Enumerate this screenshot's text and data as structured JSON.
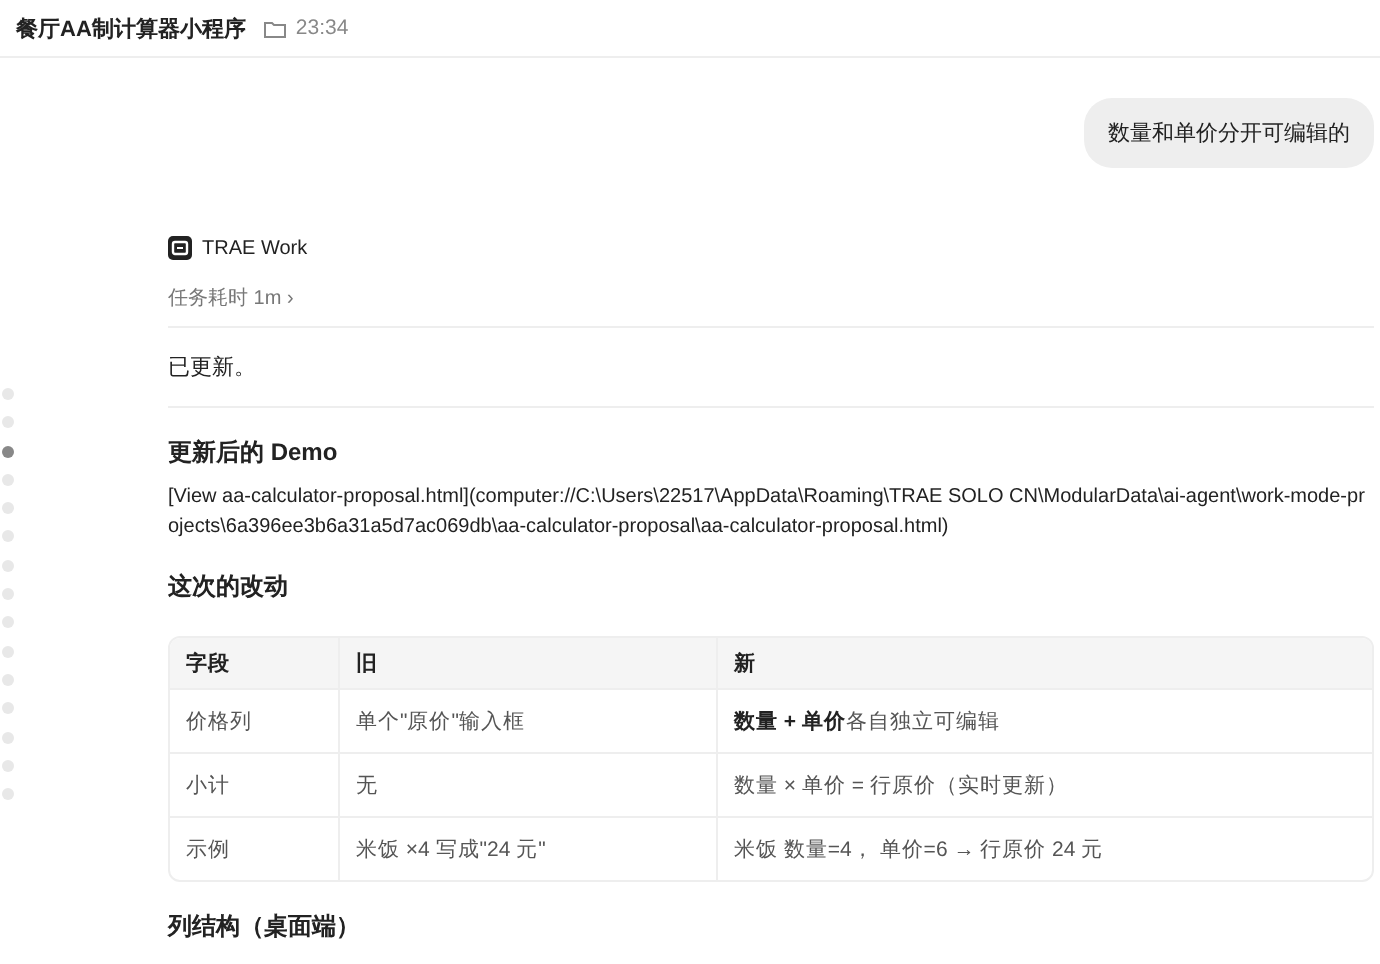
{
  "header": {
    "title": "餐厅AA制计算器小程序",
    "time": "23:34"
  },
  "user_message": "数量和单价分开可编辑的",
  "agent": {
    "name": "TRAE Work",
    "duration": "任务耗时 1m",
    "chevron": "›"
  },
  "nav_dots": [
    {
      "selected": false
    },
    {
      "selected": false
    },
    {
      "selected": true
    },
    {
      "selected": false
    },
    {
      "selected": false
    },
    {
      "selected": false
    },
    {
      "selected": false
    },
    {
      "selected": false
    },
    {
      "selected": false
    },
    {
      "selected": false
    },
    {
      "selected": false
    },
    {
      "selected": false
    },
    {
      "selected": false
    },
    {
      "selected": false
    },
    {
      "selected": false
    }
  ],
  "status": "已更新。",
  "sections": [
    {
      "heading": "更新后的 Demo",
      "paragraph": "[View aa-calculator-proposal.html](computer://C:\\Users\\22517\\AppData\\Roaming\\TRAE SOLO CN\\ModularData\\ai-agent\\work-mode-projects\\6a396ee3b6a31a5d7ac069db\\aa-calculator-proposal\\aa-calculator-proposal.html)"
    },
    {
      "heading": "这次的改动",
      "table": {
        "columns": [
          "字段",
          "旧",
          "新"
        ],
        "rows": [
          [
            "价格列",
            "单个\"原价\"输入框",
            "**数量 + 单价** 各自独立可编辑"
          ],
          [
            "小计",
            "无",
            "数量 × 单价 = 行原价（实时更新）"
          ],
          [
            "示例",
            "米饭 ×4 写成\"24 元\"",
            "米饭 数量=4， 单价=6 → 行原价 24 元"
          ]
        ]
      }
    },
    {
      "heading": "列结构（桌面端）"
    }
  ]
}
